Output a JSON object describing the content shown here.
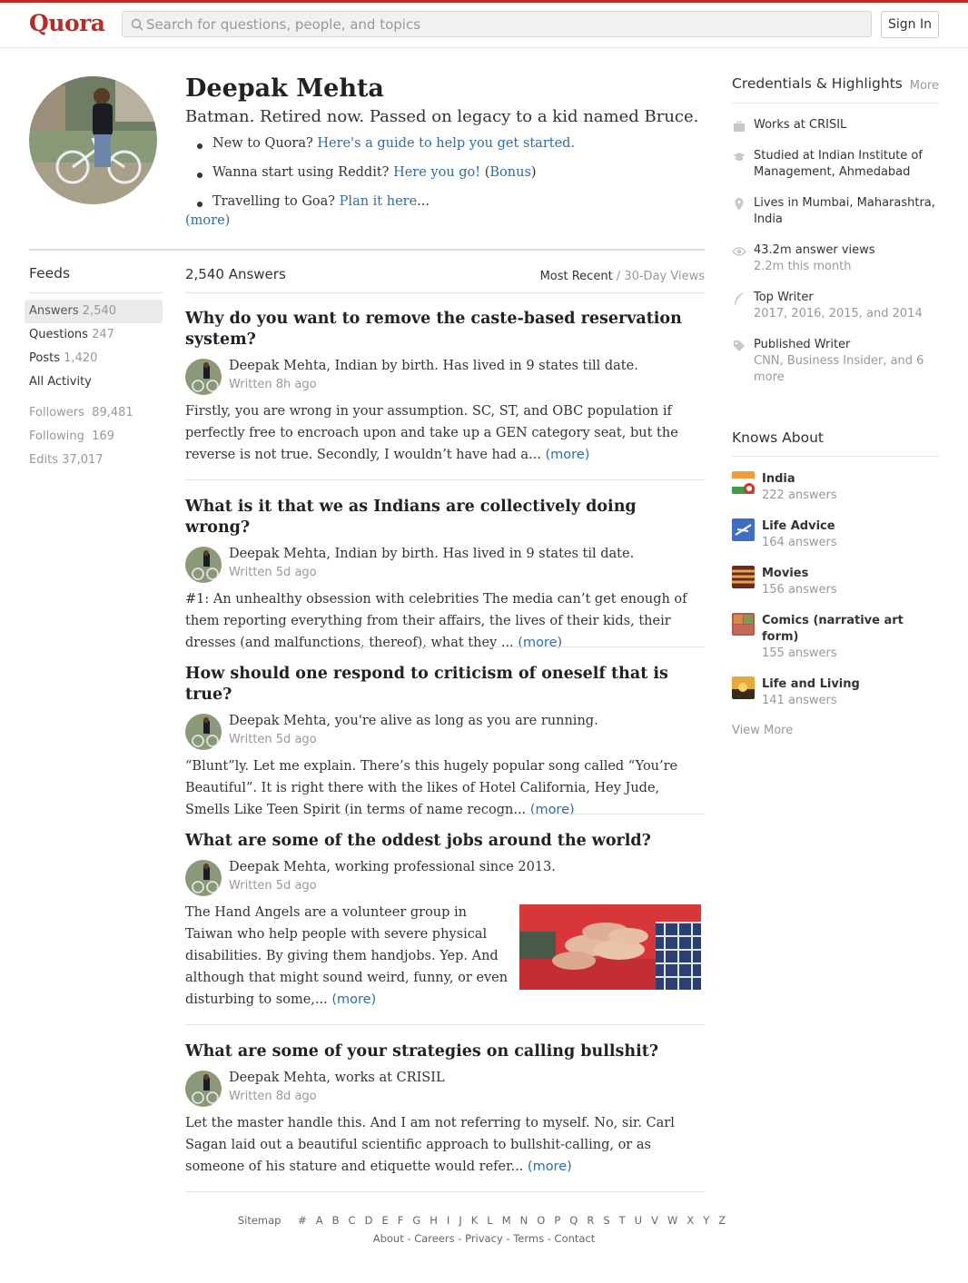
{
  "header": {
    "logo": "Quora",
    "search_placeholder": "Search for questions, people, and topics",
    "sign_in": "Sign In"
  },
  "profile": {
    "name": "Deepak Mehta",
    "tagline": "Batman. Retired now. Passed on legacy to a kid named Bruce.",
    "bio": [
      {
        "text": "New to Quora? ",
        "link": "Here's a guide to help you get started.",
        "after": ""
      },
      {
        "text": "Wanna start using Reddit? ",
        "link": "Here you go!",
        "after": " (",
        "link2": "Bonus",
        "after2": ")"
      },
      {
        "text": "Travelling to Goa? ",
        "link": "Plan it here",
        "after": "..."
      }
    ],
    "more": "(more)"
  },
  "feeds": {
    "title": "Feeds",
    "items": [
      {
        "label": "Answers",
        "count": "2,540",
        "active": true
      },
      {
        "label": "Questions",
        "count": "247"
      },
      {
        "label": "Posts",
        "count": "1,420"
      },
      {
        "label": "All Activity",
        "count": ""
      },
      {
        "label": "Followers",
        "count": "89,481"
      },
      {
        "label": "Following",
        "count": "169"
      },
      {
        "label": "Edits",
        "count": "37,017"
      }
    ]
  },
  "answers_header": {
    "count": "2,540 Answers",
    "sort_active": "Most Recent",
    "sort_sep": " / ",
    "sort_other": "30-Day Views"
  },
  "answers": [
    {
      "question": "Why do you want to remove the caste-based reservation system?",
      "credential": "Deepak Mehta, Indian by birth. Has lived in 9 states till date.",
      "when": "Written 8h ago",
      "body": "Firstly, you are wrong in your assumption. SC, ST, and OBC population if perfectly free to encroach upon and take up a GEN category seat, but the reverse is not true. Secondly, I wouldn’t have had a...",
      "more": "(more)"
    },
    {
      "question": "What is it that we as Indians are collectively doing wrong?",
      "credential": "Deepak Mehta, Indian by birth. Has lived in 9 states til date.",
      "when": "Written 5d ago",
      "body": "#1: An unhealthy obsession with celebrities The media can’t get enough of them reporting everything from their affairs, the lives of their kids, their dresses (and malfunctions, thereof), what they ...",
      "more": "(more)"
    },
    {
      "question": "How should one respond to criticism of oneself that is true?",
      "credential": "Deepak Mehta, you're alive as long as you are running.",
      "when": "Written 5d ago",
      "body": "“Blunt”ly. Let me explain. There’s this hugely popular song called “You’re Beautiful”. It is right there with the likes of Hotel California, Hey Jude, Smells Like Teen Spirit (in terms of name recogn...",
      "more": "(more)"
    },
    {
      "question": "What are some of the oddest jobs around the world?",
      "credential": "Deepak Mehta, working professional since 2013.",
      "when": "Written 5d ago",
      "body": "The Hand Angels are a volunteer group in Taiwan who help people with severe physical disabilities. By giving them handjobs. Yep. And although that might sound weird, funny, or even disturbing to some,...",
      "more": "(more)"
    },
    {
      "question": "What are some of your strategies on calling bullshit?",
      "credential": "Deepak Mehta, works at CRISIL",
      "when": "Written 8d ago",
      "body": "Let the master handle this. And I am not referring to myself. No, sir. Carl Sagan laid out a beautiful scientific approach to bullshit-calling, or as someone of his stature and etiquette would refer...",
      "more": "(more)"
    }
  ],
  "credentials": {
    "title": "Credentials & Highlights",
    "more": "More",
    "items": [
      {
        "icon": "briefcase-icon",
        "text": "Works at CRISIL",
        "sub": ""
      },
      {
        "icon": "graduation-cap-icon",
        "text": "Studied at Indian Institute of Management, Ahmedabad",
        "sub": ""
      },
      {
        "icon": "location-pin-icon",
        "text": "Lives in Mumbai, Maharashtra, India",
        "sub": ""
      },
      {
        "icon": "eye-icon",
        "text": "43.2m answer views",
        "sub": "2.2m this month"
      },
      {
        "icon": "feather-icon",
        "text": "Top Writer",
        "sub": "2017, 2016, 2015, and 2014"
      },
      {
        "icon": "tag-icon",
        "text": "Published Writer",
        "sub": "CNN, Business Insider, and 6 more"
      }
    ]
  },
  "knows_about": {
    "title": "Knows About",
    "items": [
      {
        "topic": "India",
        "answers": "222 answers"
      },
      {
        "topic": "Life Advice",
        "answers": "164 answers"
      },
      {
        "topic": "Movies",
        "answers": "156 answers"
      },
      {
        "topic": "Comics (narrative art form)",
        "answers": "155 answers"
      },
      {
        "topic": "Life and Living",
        "answers": "141 answers"
      }
    ],
    "view_more": "View More"
  },
  "footer": {
    "sitemap": "Sitemap",
    "letters": [
      "#",
      "A",
      "B",
      "C",
      "D",
      "E",
      "F",
      "G",
      "H",
      "I",
      "J",
      "K",
      "L",
      "M",
      "N",
      "O",
      "P",
      "Q",
      "R",
      "S",
      "T",
      "U",
      "V",
      "W",
      "X",
      "Y",
      "Z"
    ],
    "links": [
      "About",
      "Careers",
      "Privacy",
      "Terms",
      "Contact"
    ],
    "link_sep": " - "
  },
  "colors": {
    "brand": "#b92b27",
    "link": "#2b6dad",
    "muted": "#999999"
  }
}
